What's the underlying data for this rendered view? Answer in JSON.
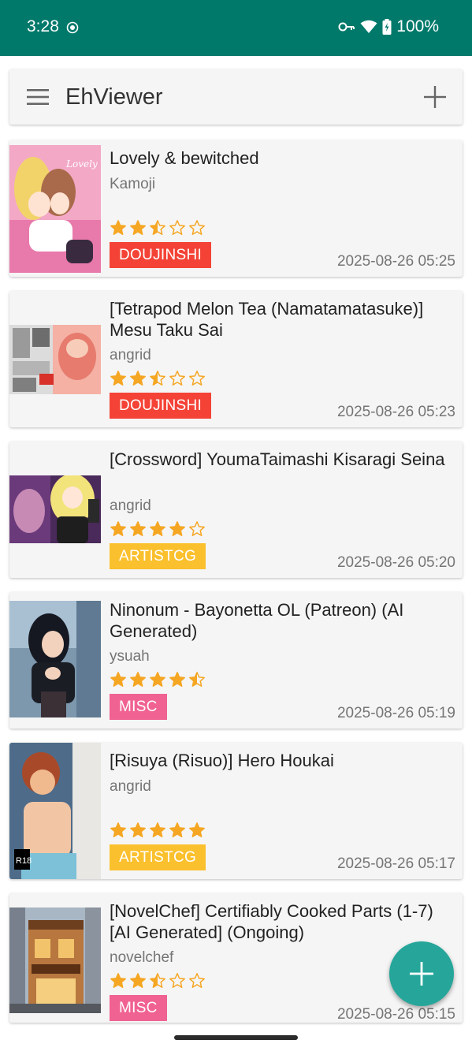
{
  "status_bar": {
    "time": "3:28",
    "battery": "100%",
    "icons": [
      "record-icon",
      "key-icon",
      "wifi-icon",
      "battery-charging-icon"
    ]
  },
  "toolbar": {
    "title": "EhViewer",
    "menu_icon": "hamburger-menu-icon",
    "add_icon": "plus-icon"
  },
  "colors": {
    "status_bar": "#00796B",
    "fab": "#26a69a",
    "star": "#f5a623",
    "doujinshi": "#f44336",
    "artistcg": "#fbc02d",
    "misc": "#f06292"
  },
  "galleries": [
    {
      "title": "Lovely & bewitched",
      "uploader": "Kamoji",
      "rating": 2.5,
      "category": "DOUJINSHI",
      "category_color": "#f44336",
      "date": "2025-08-26 05:25"
    },
    {
      "title": "[Tetrapod Melon Tea (Namatamatasuke)] Mesu Taku Sai",
      "uploader": "angrid",
      "rating": 2.5,
      "category": "DOUJINSHI",
      "category_color": "#f44336",
      "date": "2025-08-26 05:23"
    },
    {
      "title": "[Crossword] YoumaTaimashi Kisaragi Seina",
      "uploader": "angrid",
      "rating": 4,
      "category": "ARTISTCG",
      "category_color": "#fbc02d",
      "date": "2025-08-26 05:20"
    },
    {
      "title": "Ninonum - Bayonetta OL (Patreon) (AI Generated)",
      "uploader": "ysuah",
      "rating": 4.5,
      "category": "MISC",
      "category_color": "#f06292",
      "date": "2025-08-26 05:19"
    },
    {
      "title": "[Risuya (Risuo)] Hero Houkai",
      "uploader": "angrid",
      "rating": 5,
      "category": "ARTISTCG",
      "category_color": "#fbc02d",
      "date": "2025-08-26 05:17"
    },
    {
      "title": "[NovelChef] Certifiably Cooked Parts (1-7) [AI Generated] (Ongoing)",
      "uploader": "novelchef",
      "rating": 2.5,
      "category": "MISC",
      "category_color": "#f06292",
      "date": "2025-08-26 05:15"
    }
  ],
  "fab": {
    "icon": "plus-icon"
  }
}
